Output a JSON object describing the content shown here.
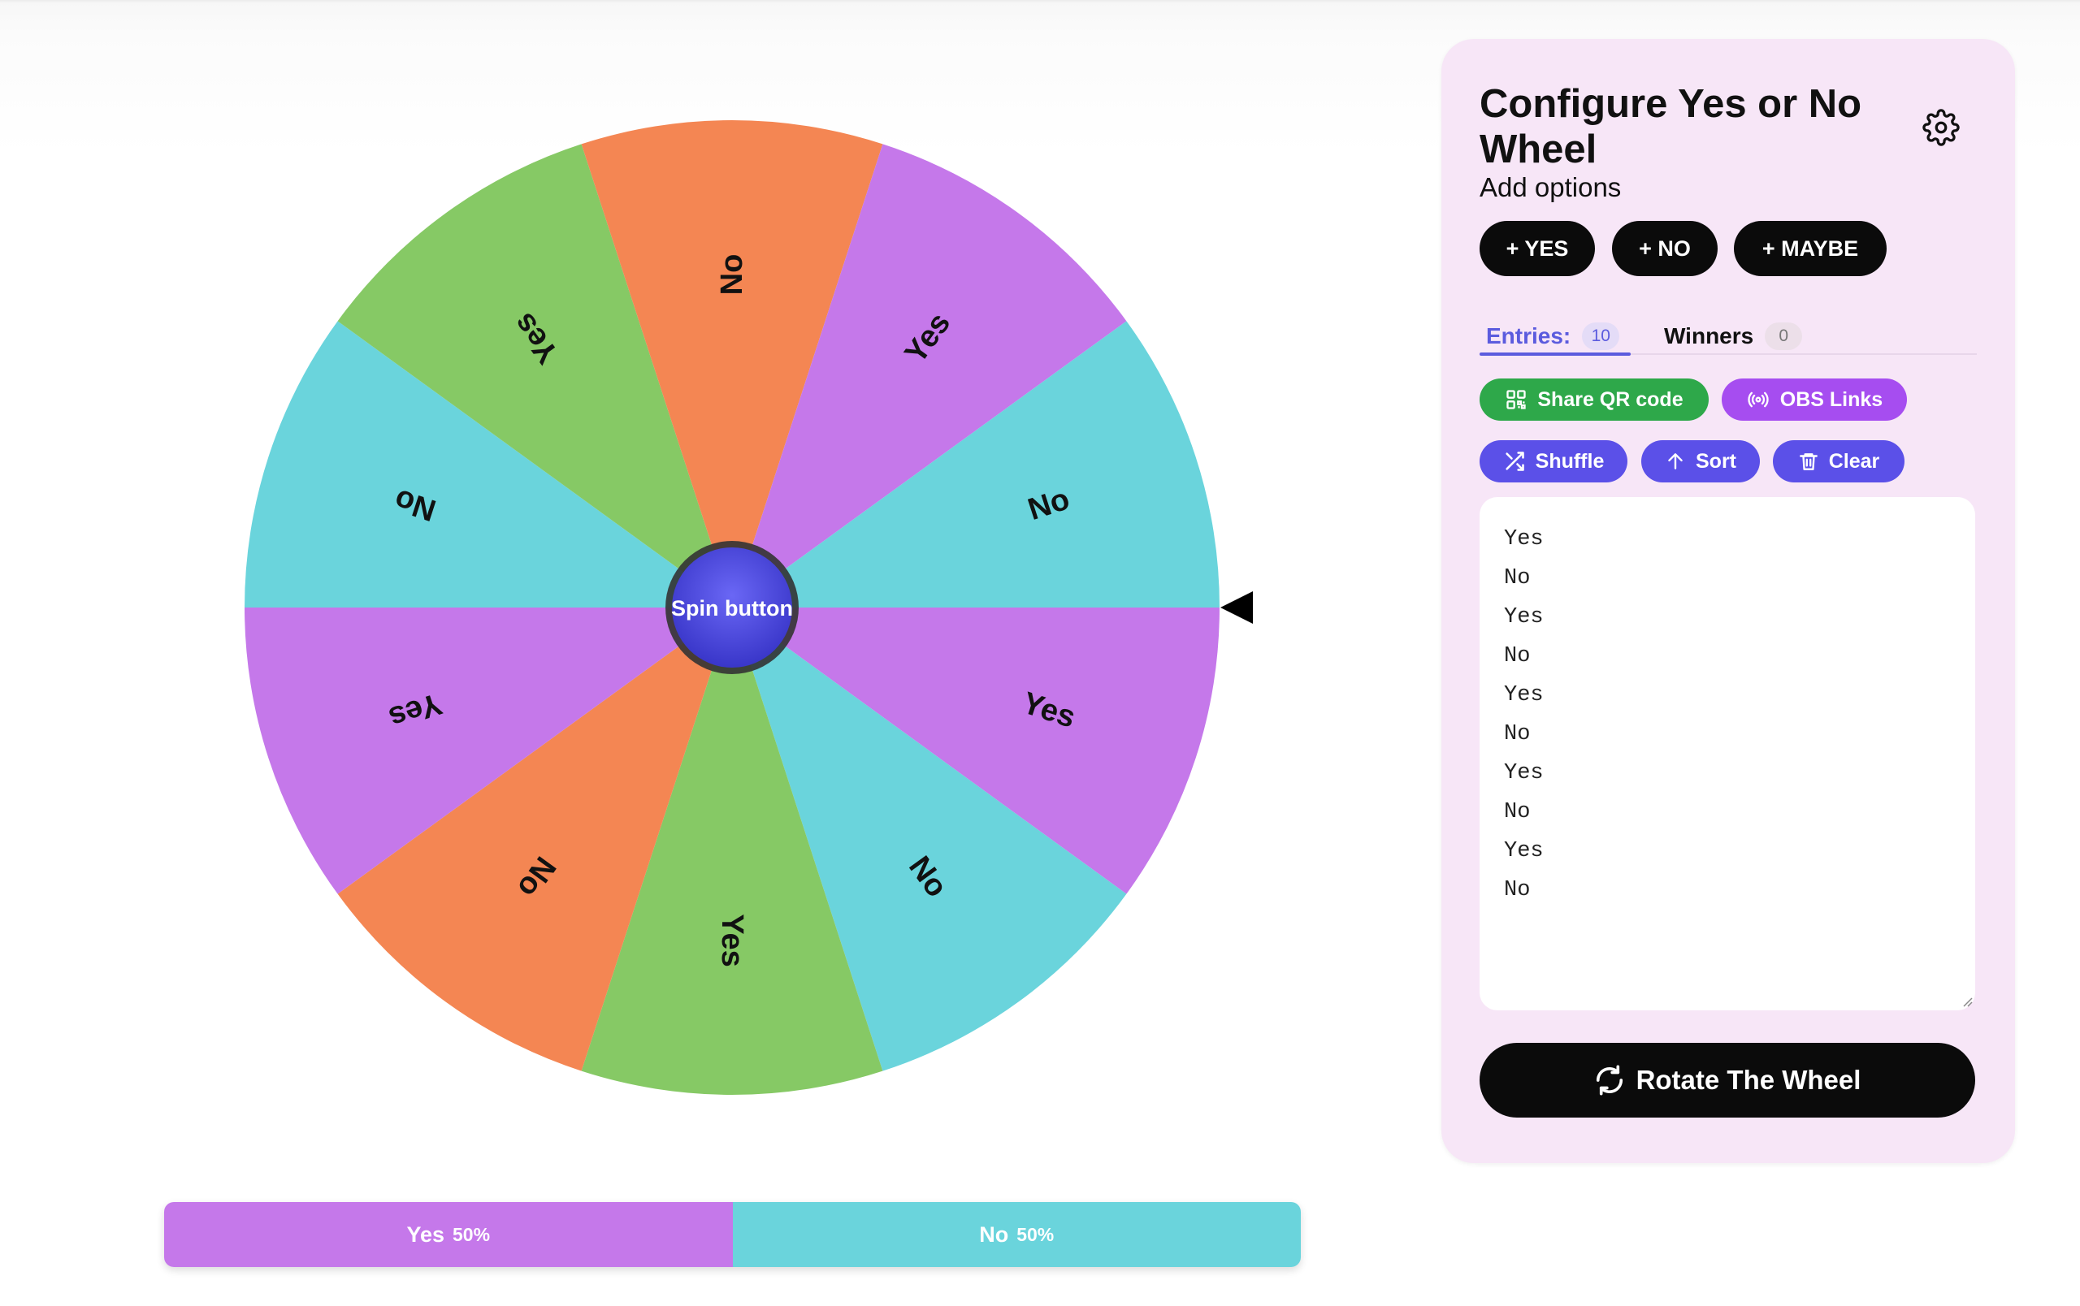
{
  "colors": {
    "purple": "#c578ea",
    "cyan": "#6ad4dc",
    "orange": "#f48653",
    "green": "#86c965",
    "spin_button": "#4a47e0",
    "panel_bg": "#f7e6f7",
    "tab_active": "#5b5bde",
    "share_green": "#2ea84a",
    "obs_purple": "#a64df0",
    "action_blue": "#5b50e8"
  },
  "wheel": {
    "spin_label": "Spin button",
    "segments": [
      {
        "label": "Yes",
        "color": "#c578ea"
      },
      {
        "label": "No",
        "color": "#6ad4dc"
      },
      {
        "label": "Yes",
        "color": "#86c965"
      },
      {
        "label": "No",
        "color": "#f48653"
      },
      {
        "label": "Yes",
        "color": "#c578ea"
      },
      {
        "label": "No",
        "color": "#6ad4dc"
      },
      {
        "label": "Yes",
        "color": "#86c965"
      },
      {
        "label": "No",
        "color": "#f48653"
      },
      {
        "label": "Yes",
        "color": "#c578ea"
      },
      {
        "label": "No",
        "color": "#6ad4dc"
      }
    ]
  },
  "distribution": [
    {
      "name": "Yes",
      "percent": "50%",
      "fraction": 0.5,
      "color": "#c578ea"
    },
    {
      "name": "No",
      "percent": "50%",
      "fraction": 0.5,
      "color": "#6ad4dc"
    }
  ],
  "panel": {
    "title": "Configure Yes or No Wheel",
    "subtitle": "Add options",
    "settings_icon": "gear-icon",
    "quick_add": {
      "yes": "+ YES",
      "no": "+ NO",
      "maybe": "+ MAYBE"
    },
    "tabs": {
      "entries_label": "Entries:",
      "entries_count": "10",
      "winners_label": "Winners",
      "winners_count": "0"
    },
    "actions": {
      "share_qr": "Share QR code",
      "obs_links": "OBS Links",
      "shuffle": "Shuffle",
      "sort": "Sort",
      "clear": "Clear"
    },
    "entries": [
      "Yes",
      "No",
      "Yes",
      "No",
      "Yes",
      "No",
      "Yes",
      "No",
      "Yes",
      "No"
    ],
    "rotate_label": "Rotate The Wheel"
  }
}
